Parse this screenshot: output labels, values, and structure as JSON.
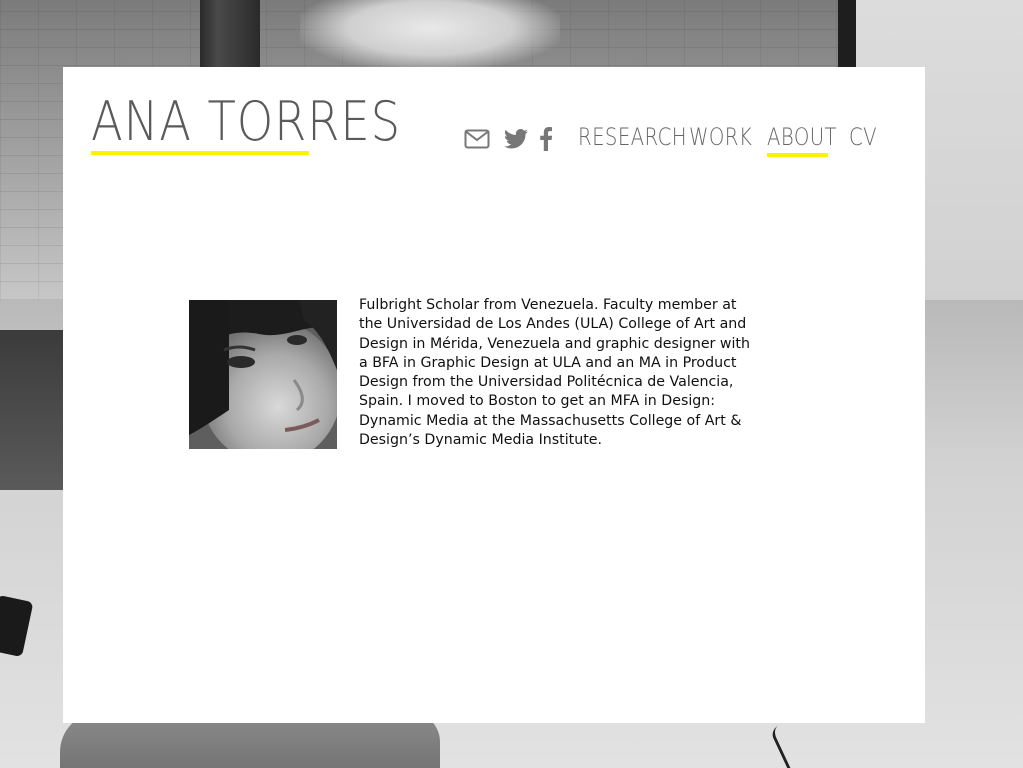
{
  "site": {
    "name": "ANA TORRES",
    "accent_color": "#fff200",
    "text_color": "#666666"
  },
  "nav": {
    "icons": [
      {
        "name": "mail-icon"
      },
      {
        "name": "twitter-icon"
      },
      {
        "name": "facebook-icon"
      }
    ],
    "items": [
      {
        "label": "RESEARCH",
        "active": false
      },
      {
        "label": "WORK",
        "active": false
      },
      {
        "label": "ABOUT",
        "active": true
      },
      {
        "label": "CV",
        "active": false
      }
    ]
  },
  "about": {
    "bio": "Fulbright Scholar from Venezuela. Faculty member at the Universidad de Los Andes (ULA) College of Art and Design in Mérida, Venezuela and graphic designer with a BFA in Graphic Design at ULA and an MA in Product Design from the Universidad Politécnica de Valencia, Spain. I moved to Boston to get an MFA in Design: Dynamic Media at the Massachusetts College of Art & Design’s Dynamic Media Institute."
  }
}
